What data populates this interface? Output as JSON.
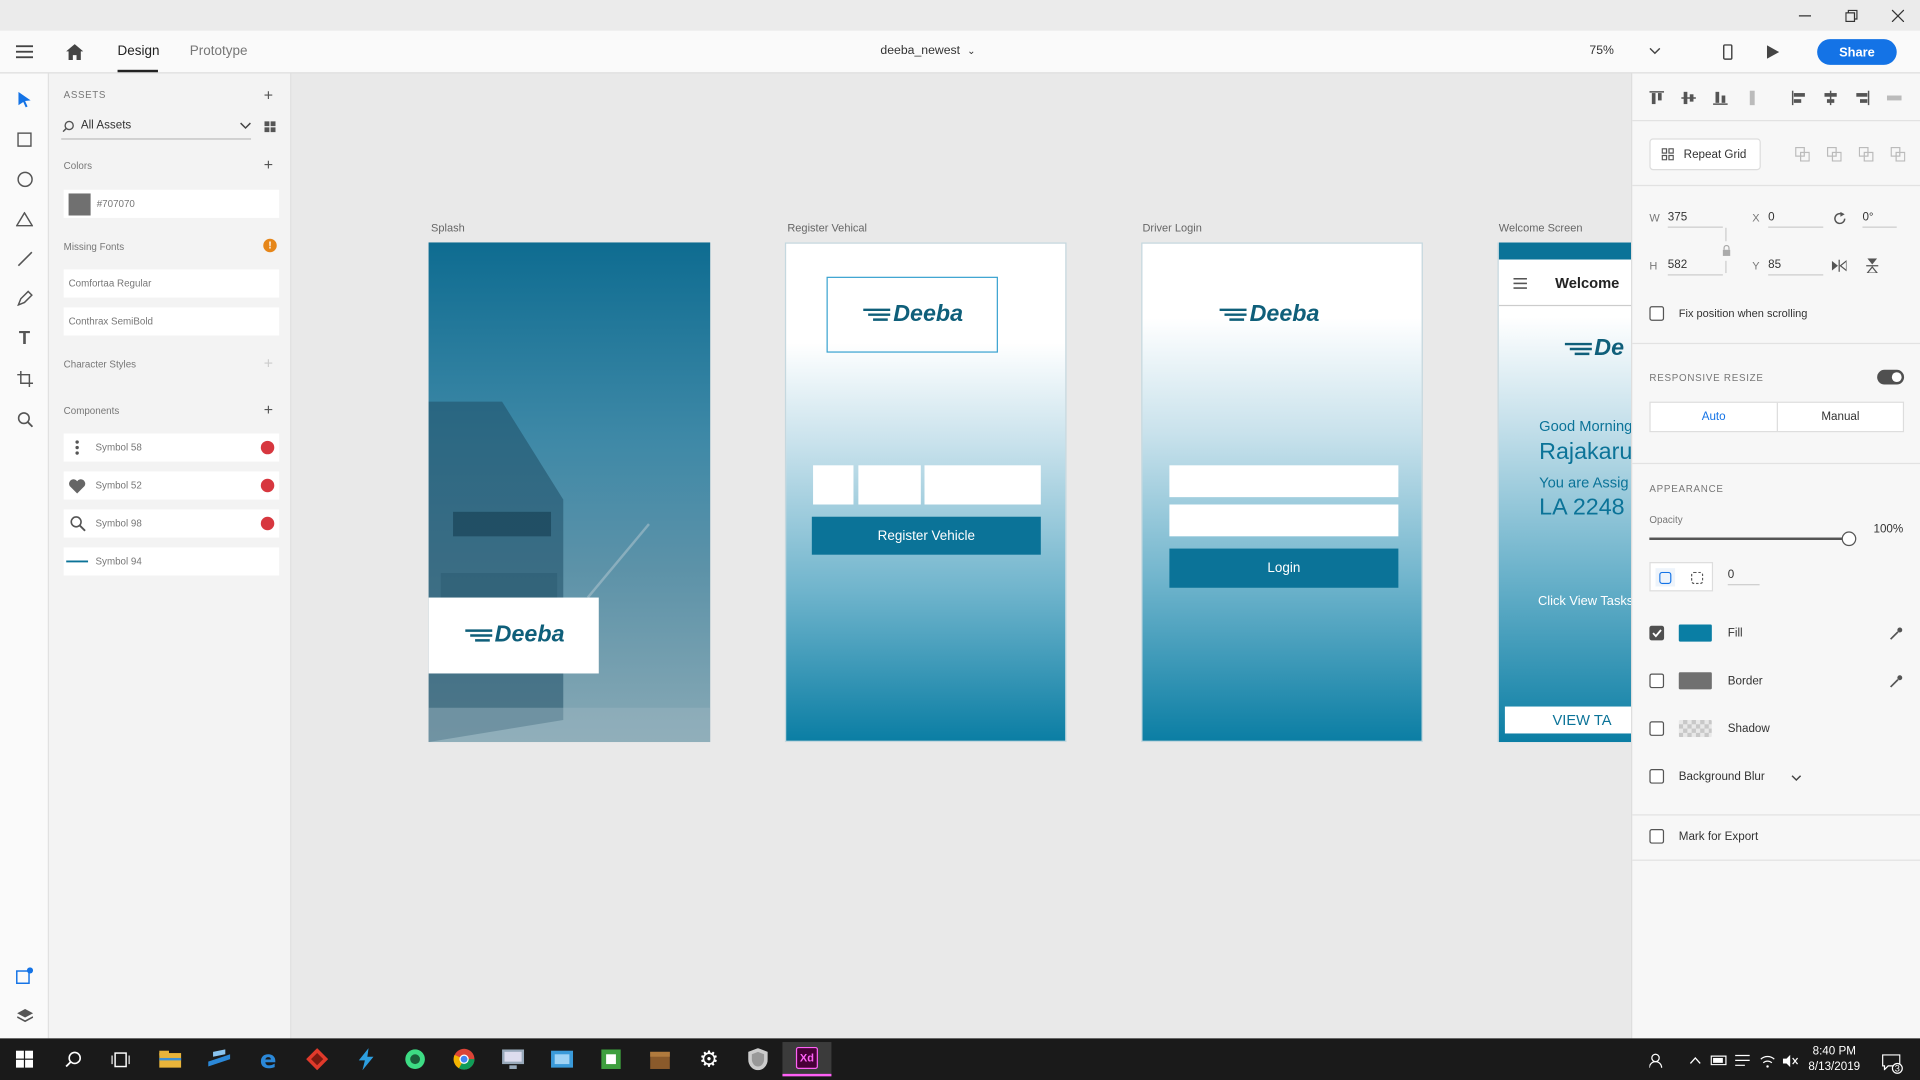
{
  "toolbar": {
    "tab_design": "Design",
    "tab_prototype": "Prototype",
    "doc_title": "deeba_newest",
    "zoom": "75%",
    "share": "Share"
  },
  "assets": {
    "header": "ASSETS",
    "filter": "All Assets",
    "colors_label": "Colors",
    "color_hex": "#707070",
    "missing_fonts_label": "Missing Fonts",
    "fonts": [
      "Comfortaa Regular",
      "Conthrax SemiBold"
    ],
    "char_styles_label": "Character Styles",
    "components_label": "Components",
    "components": [
      "Symbol 58",
      "Symbol 52",
      "Symbol 98",
      "Symbol 94"
    ]
  },
  "artboards": {
    "splash": {
      "name": "Splash",
      "logo": "Deeba"
    },
    "register": {
      "name": "Register Vehical",
      "logo": "Deeba",
      "button": "Register Vehicle"
    },
    "login": {
      "name": "Driver Login",
      "logo": "Deeba",
      "button": "Login"
    },
    "welcome": {
      "name": "Welcome Screen",
      "header": "Welcome",
      "logo": "De",
      "greeting": "Good Morning",
      "name_text": "Rajakaru",
      "assigned": "You are Assig",
      "plate": "LA 2248",
      "hint": "Click View Tasks",
      "view_btn": "VIEW TA"
    }
  },
  "props": {
    "repeat_grid": "Repeat Grid",
    "w_label": "W",
    "w": "375",
    "x_label": "X",
    "x": "0",
    "h_label": "H",
    "h": "582",
    "y_label": "Y",
    "y": "85",
    "rotation": "0°",
    "fix_position": "Fix position when scrolling",
    "responsive_resize": "RESPONSIVE RESIZE",
    "auto": "Auto",
    "manual": "Manual",
    "appearance": "APPEARANCE",
    "opacity_label": "Opacity",
    "opacity": "100%",
    "opacity_level": 1.0,
    "radius": "0",
    "fill": "Fill",
    "border": "Border",
    "shadow": "Shadow",
    "bg_blur": "Background Blur",
    "mark_export": "Mark for Export",
    "fill_color": "#0a7ea4",
    "border_color": "#707070"
  },
  "taskbar": {
    "time": "8:40 PM",
    "date": "8/13/2019",
    "notifications": "3",
    "xd": "Xd"
  },
  "colors": {
    "accent": "#1473e6",
    "brand_teal": "#0b7398",
    "dark_teal": "#0f5f7a"
  }
}
